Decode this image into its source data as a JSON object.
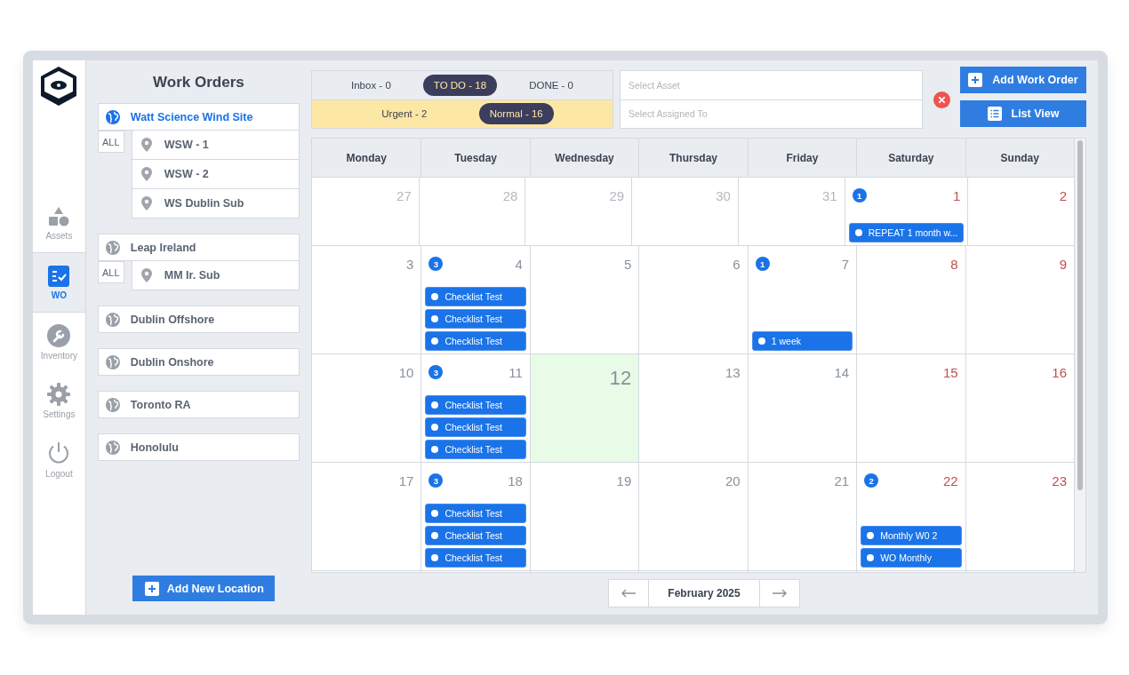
{
  "nav": {
    "items": [
      {
        "label": "Assets",
        "selected": false
      },
      {
        "label": "WO",
        "selected": true
      },
      {
        "label": "Inventory",
        "selected": false
      },
      {
        "label": "Settings",
        "selected": false
      },
      {
        "label": "Logout",
        "selected": false
      }
    ]
  },
  "sidebar": {
    "title": "Work Orders",
    "locations": [
      {
        "name": "Watt Science Wind Site",
        "selected": true,
        "all_label": "ALL",
        "children": [
          {
            "name": "WSW - 1"
          },
          {
            "name": "WSW - 2"
          },
          {
            "name": "WS Dublin Sub"
          }
        ]
      },
      {
        "name": "Leap Ireland",
        "selected": false,
        "all_label": "ALL",
        "children": [
          {
            "name": "MM Ir. Sub"
          }
        ]
      },
      {
        "name": "Dublin Offshore",
        "selected": false
      },
      {
        "name": "Dublin Onshore",
        "selected": false
      },
      {
        "name": "Toronto RA",
        "selected": false
      },
      {
        "name": "Honolulu",
        "selected": false
      }
    ],
    "add_button": "Add New Location"
  },
  "status_tabs": [
    {
      "label": "Inbox - 0",
      "selected": false
    },
    {
      "label": "TO DO - 18",
      "selected": true
    },
    {
      "label": "DONE - 0",
      "selected": false
    }
  ],
  "priority_tabs": [
    {
      "label": "Urgent - 2",
      "selected": false
    },
    {
      "label": "Normal - 16",
      "selected": true
    }
  ],
  "filters": [
    {
      "placeholder": "Select Asset"
    },
    {
      "placeholder": "Select Assigned To"
    }
  ],
  "buttons": [
    {
      "label": "Add Work Order",
      "kind": "add"
    },
    {
      "label": "List View",
      "kind": "list"
    }
  ],
  "calendar": {
    "days": [
      "Monday",
      "Tuesday",
      "Wednesday",
      "Thursday",
      "Friday",
      "Saturday",
      "Sunday"
    ],
    "weeks": [
      [
        {
          "day": "27",
          "kind": "other"
        },
        {
          "day": "28",
          "kind": "other"
        },
        {
          "day": "29",
          "kind": "other"
        },
        {
          "day": "30",
          "kind": "other"
        },
        {
          "day": "31",
          "kind": "other"
        },
        {
          "day": "1",
          "kind": "weekend",
          "badge": "1",
          "events": [
            "REPEAT 1 month w..."
          ]
        },
        {
          "day": "2",
          "kind": "weekend"
        }
      ],
      [
        {
          "day": "3",
          "kind": "weekday"
        },
        {
          "day": "4",
          "kind": "weekday",
          "badge": "3",
          "events": [
            "Checklist Test",
            "Checklist Test",
            "Checklist Test"
          ]
        },
        {
          "day": "5",
          "kind": "weekday"
        },
        {
          "day": "6",
          "kind": "weekday"
        },
        {
          "day": "7",
          "kind": "weekday",
          "badge": "1",
          "events": [
            "1 week"
          ]
        },
        {
          "day": "8",
          "kind": "weekend"
        },
        {
          "day": "9",
          "kind": "weekend"
        }
      ],
      [
        {
          "day": "10",
          "kind": "weekday"
        },
        {
          "day": "11",
          "kind": "weekday",
          "badge": "3",
          "events": [
            "Checklist Test",
            "Checklist Test",
            "Checklist Test"
          ]
        },
        {
          "day": "12",
          "kind": "today"
        },
        {
          "day": "13",
          "kind": "weekday"
        },
        {
          "day": "14",
          "kind": "weekday"
        },
        {
          "day": "15",
          "kind": "weekend"
        },
        {
          "day": "16",
          "kind": "weekend"
        }
      ],
      [
        {
          "day": "17",
          "kind": "weekday"
        },
        {
          "day": "18",
          "kind": "weekday",
          "badge": "3",
          "events": [
            "Checklist Test",
            "Checklist Test",
            "Checklist Test"
          ]
        },
        {
          "day": "19",
          "kind": "weekday"
        },
        {
          "day": "20",
          "kind": "weekday"
        },
        {
          "day": "21",
          "kind": "weekday"
        },
        {
          "day": "22",
          "kind": "weekend",
          "badge": "2",
          "events": [
            "Monthly W0 2",
            "WO Monthly"
          ]
        },
        {
          "day": "23",
          "kind": "weekend"
        }
      ]
    ],
    "month": "February 2025"
  }
}
